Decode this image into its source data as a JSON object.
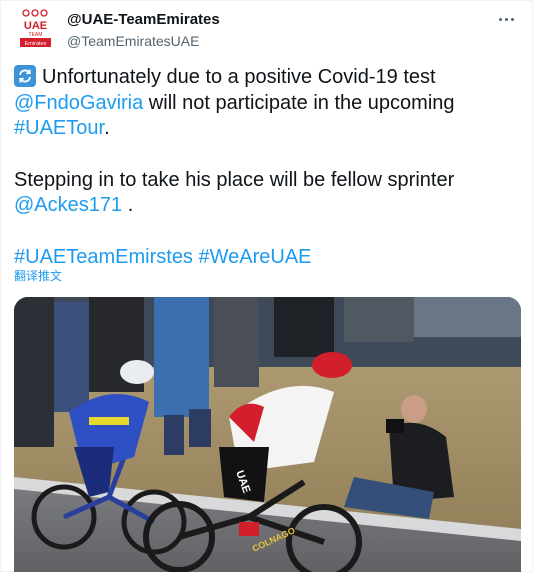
{
  "tweet": {
    "author": {
      "display_name": "@UAE-TeamEmirates",
      "handle": "@TeamEmiratesUAE",
      "avatar_text_top": "UAE",
      "avatar_text_mid": "TEAM",
      "avatar_text_bottom": "Emirates"
    },
    "more_icon": "more-horizontal-icon",
    "text": {
      "line1": "Unfortunately due to a positive Covid-19 test",
      "mention1": "@FndoGaviria",
      "line2_rest": " will not participate in the upcoming",
      "hashtag1": "#UAETour",
      "period1": ".",
      "line4": "Stepping in to take his place will be fellow sprinter",
      "mention2": "@Ackes171",
      "period2": " .",
      "hashtag2": "#UAETeamEmirstes",
      "hashtag3": "#WeAreUAE"
    },
    "translate_label": "翻译推文",
    "media": {
      "rider_jersey_text": "UAE",
      "bike_brand_text": "COLNAGO"
    }
  },
  "colors": {
    "link": "#1d9bf0",
    "text": "#0f1419",
    "secondary": "#536471",
    "repeat_emoji": "#3b94d9",
    "brand_red": "#d21f2b"
  }
}
